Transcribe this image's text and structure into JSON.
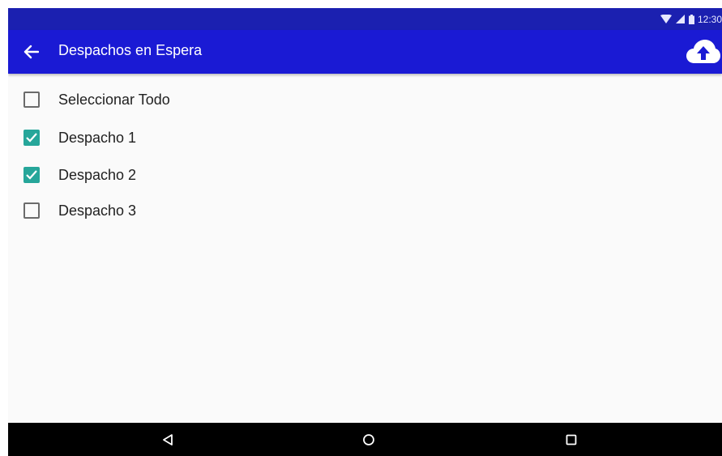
{
  "status_bar": {
    "time": "12:30",
    "icons": [
      "wifi-icon",
      "cell-signal-icon",
      "battery-icon"
    ]
  },
  "app_bar": {
    "title": "Despachos en Espera",
    "back_icon": "arrow-back-icon",
    "action_icon": "cloud-upload-icon",
    "background": "#1a1ad4"
  },
  "list": {
    "items": [
      {
        "label": "Seleccionar Todo",
        "checked": false
      },
      {
        "label": "Despacho 1",
        "checked": true
      },
      {
        "label": "Despacho 2",
        "checked": true
      },
      {
        "label": "Despacho 3",
        "checked": false
      }
    ]
  },
  "nav_bar": {
    "buttons": [
      "back-triangle-icon",
      "home-circle-icon",
      "recents-square-icon"
    ]
  },
  "colors": {
    "status_bar": "#1b20b0",
    "checkbox_checked": "#26a69a",
    "content_bg": "#fafafa"
  }
}
